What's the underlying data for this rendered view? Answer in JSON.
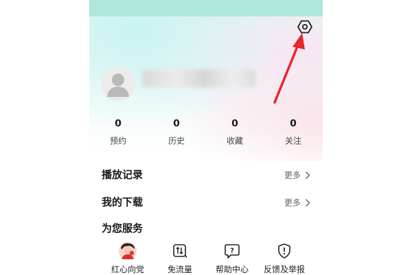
{
  "profile": {
    "stats": [
      {
        "value": "0",
        "label": "预约"
      },
      {
        "value": "0",
        "label": "历史"
      },
      {
        "value": "0",
        "label": "收藏"
      },
      {
        "value": "0",
        "label": "关注"
      }
    ]
  },
  "records": {
    "title": "播放记录",
    "more_label": "更多"
  },
  "downloads": {
    "title": "我的下载",
    "more_label": "更多"
  },
  "services": {
    "title": "为您服务",
    "items": [
      {
        "label": "红心向党",
        "icon": "red-heart-avatar-icon"
      },
      {
        "label": "免流量",
        "icon": "data-transfer-icon"
      },
      {
        "label": "帮助中心",
        "icon": "help-icon"
      },
      {
        "label": "反馈及举报",
        "icon": "report-icon"
      }
    ]
  },
  "colors": {
    "annotation_arrow": "#e8262b",
    "status_strip": "#aee7dc"
  }
}
